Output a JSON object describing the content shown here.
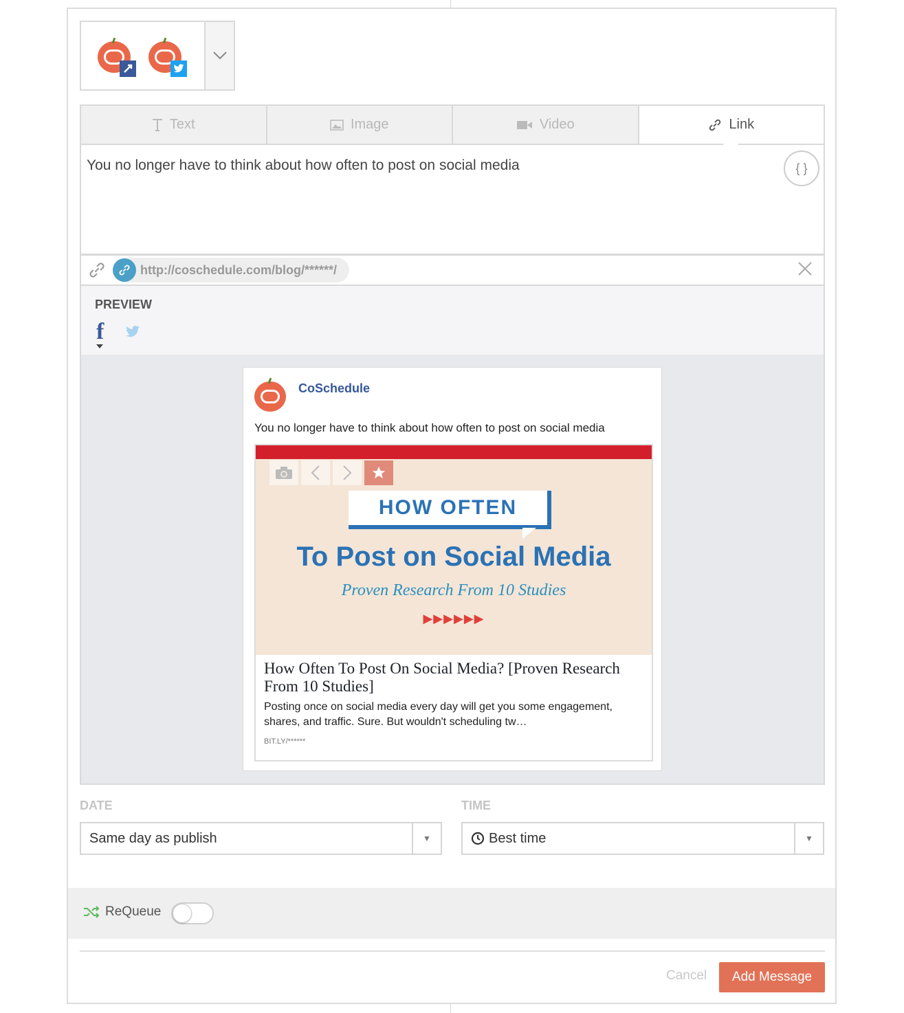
{
  "profiles": {
    "items": [
      {
        "brand_mark": "Co",
        "network": "facebook",
        "network_icon": "facebook-icon"
      },
      {
        "brand_mark": "Co",
        "network": "twitter",
        "network_icon": "twitter-icon"
      }
    ],
    "brand_color": "#e9684a"
  },
  "tabs": [
    {
      "label": "Text",
      "icon": "text-icon",
      "active": false
    },
    {
      "label": "Image",
      "icon": "image-icon",
      "active": false
    },
    {
      "label": "Video",
      "icon": "video-icon",
      "active": false
    },
    {
      "label": "Link",
      "icon": "link-icon",
      "active": true
    }
  ],
  "composer": {
    "message": "You no longer have to think about how often to post on social media",
    "variables_button": "{ }"
  },
  "link": {
    "url": "http://coschedule.com/blog/******/"
  },
  "preview": {
    "title": "PREVIEW",
    "networks": [
      "facebook",
      "twitter"
    ],
    "post": {
      "page_name": "CoSchedule",
      "message": "You no longer have to think about how often to post on social media",
      "image": {
        "badge": "HOW OFTEN",
        "title": "To Post on Social Media",
        "subtitle": "Proven Research From 10 Studies",
        "arrows": "▶▶▶▶▶▶"
      },
      "link_title": "How Often To Post On Social Media? [Proven Research From 10 Studies]",
      "link_description": "Posting once on social media every day will get you some engagement, shares, and traffic. Sure. But wouldn't scheduling tw…",
      "link_domain": "BIT.LY/******"
    }
  },
  "schedule": {
    "date_label": "DATE",
    "date_value": "Same day as publish",
    "time_label": "TIME",
    "time_value": "Best time"
  },
  "requeue": {
    "label": "ReQueue",
    "enabled": false
  },
  "actions": {
    "cancel": "Cancel",
    "submit": "Add Message"
  },
  "colors": {
    "accent": "#e27257",
    "facebook": "#3b5998",
    "twitter": "#1da1f2",
    "link_blue": "#4aa0c7",
    "headline_blue": "#2a72b5"
  }
}
